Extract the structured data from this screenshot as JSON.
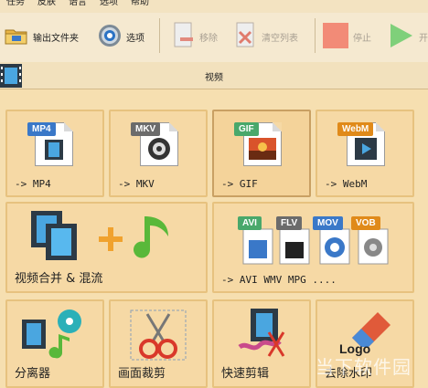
{
  "menubar": {
    "items": [
      "任务",
      "皮肤",
      "语言",
      "选项",
      "帮助"
    ]
  },
  "toolbar": {
    "output_folder": "输出文件夹",
    "options": "选项",
    "remove": "移除",
    "clear_list": "清空列表",
    "stop": "停止",
    "start": "开"
  },
  "section": {
    "title": "视频"
  },
  "tiles": [
    {
      "label": "-> MP4",
      "badge": "MP4",
      "badge_color": "#3a78c8"
    },
    {
      "label": "-> MKV",
      "badge": "MKV",
      "badge_color": "#6b6b6b"
    },
    {
      "label": "-> GIF",
      "badge": "GIF",
      "badge_color": "#49a86b"
    },
    {
      "label": "-> WebM",
      "badge": "WebM",
      "badge_color": "#e08a1a"
    },
    {
      "label": "视频合并 & 混流"
    },
    {
      "label": "-> AVI WMV MPG ....",
      "badges": [
        "AVI",
        "FLV",
        "MOV",
        "VOB"
      ]
    },
    {
      "label": "分离器"
    },
    {
      "label": "画面裁剪"
    },
    {
      "label": "快速剪辑"
    },
    {
      "label": "去除水印",
      "logo_text": "Logo"
    }
  ],
  "watermark": "当下软件园",
  "colors": {
    "accent": "#e7c27f",
    "background": "#f6dfb0"
  }
}
